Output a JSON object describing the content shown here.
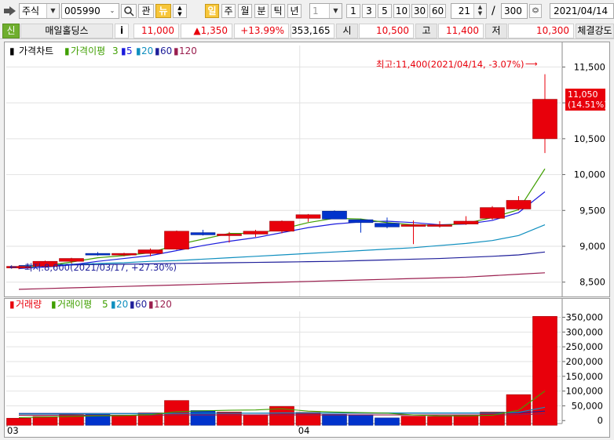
{
  "toolbar": {
    "market_type": "주식",
    "stock_code": "005990",
    "btn_interest": "관",
    "btn_news": "뉴",
    "period_buttons": [
      "일",
      "주",
      "월",
      "분",
      "틱",
      "년"
    ],
    "interval_select": "1",
    "quick_intervals": [
      "1",
      "3",
      "5",
      "10",
      "30",
      "60"
    ],
    "bar_count": "21",
    "slash": "/",
    "total_count": "300",
    "date": "2021/04/14"
  },
  "quote": {
    "credit_badge": "신",
    "stock_name": "매일홀딩스",
    "info_button": "i",
    "price": "11,000",
    "change": "▲1,350",
    "change_pct": "+13.99%",
    "volume": "353,165",
    "open_label": "시",
    "open": "10,500",
    "high_label": "고",
    "high": "11,400",
    "low_label": "저",
    "low": "10,300",
    "strength_label": "체결강도"
  },
  "colors": {
    "up": "#e8000b",
    "down": "#0033cc",
    "ma3": "#3f9f00",
    "ma5": "#1a1adc",
    "ma20": "#0f8fbf",
    "ma60": "#1e1e9a",
    "ma120": "#9a1e4e"
  },
  "chart_data": [
    {
      "type": "candlestick",
      "legend": [
        {
          "text": "가격차트",
          "color": "#000000"
        },
        {
          "text": "가격이평",
          "color": "#3f9f00"
        },
        {
          "text": "3",
          "color": "#3f9f00"
        },
        {
          "text": "5",
          "color": "#1a1adc"
        },
        {
          "text": "20",
          "color": "#0f8fbf"
        },
        {
          "text": "60",
          "color": "#1e1e9a"
        },
        {
          "text": "120",
          "color": "#9a1e4e"
        }
      ],
      "ylim": [
        8300,
        11800
      ],
      "yticks": [
        "8,500",
        "9,000",
        "9,500",
        "10,000",
        "10,500",
        "11,000",
        "11,500"
      ],
      "ytick_values": [
        8500,
        9000,
        9500,
        10000,
        10500,
        11000,
        11500
      ],
      "xticks": [
        {
          "label": "03",
          "index": 0
        },
        {
          "label": "04",
          "index": 11
        }
      ],
      "candles": [
        {
          "o": 8700,
          "h": 8730,
          "l": 8680,
          "c": 8720
        },
        {
          "o": 8720,
          "h": 8800,
          "l": 8700,
          "c": 8790
        },
        {
          "o": 8790,
          "h": 8840,
          "l": 8760,
          "c": 8830
        },
        {
          "o": 8900,
          "h": 8920,
          "l": 8870,
          "c": 8890
        },
        {
          "o": 8890,
          "h": 8910,
          "l": 8860,
          "c": 8900
        },
        {
          "o": 8900,
          "h": 8970,
          "l": 8860,
          "c": 8950
        },
        {
          "o": 8960,
          "h": 9220,
          "l": 8950,
          "c": 9210
        },
        {
          "o": 9190,
          "h": 9230,
          "l": 9150,
          "c": 9160
        },
        {
          "o": 9170,
          "h": 9200,
          "l": 9050,
          "c": 9170
        },
        {
          "o": 9170,
          "h": 9230,
          "l": 9130,
          "c": 9210
        },
        {
          "o": 9210,
          "h": 9360,
          "l": 9180,
          "c": 9350
        },
        {
          "o": 9390,
          "h": 9450,
          "l": 9340,
          "c": 9440
        },
        {
          "o": 9490,
          "h": 9500,
          "l": 9380,
          "c": 9380
        },
        {
          "o": 9370,
          "h": 9380,
          "l": 9190,
          "c": 9330
        },
        {
          "o": 9320,
          "h": 9400,
          "l": 9250,
          "c": 9270
        },
        {
          "o": 9290,
          "h": 9360,
          "l": 9030,
          "c": 9300
        },
        {
          "o": 9300,
          "h": 9350,
          "l": 9260,
          "c": 9300
        },
        {
          "o": 9310,
          "h": 9420,
          "l": 9300,
          "c": 9350
        },
        {
          "o": 9390,
          "h": 9560,
          "l": 9370,
          "c": 9540
        },
        {
          "o": 9520,
          "h": 9700,
          "l": 9500,
          "c": 9640
        },
        {
          "o": 10500,
          "h": 11400,
          "l": 10300,
          "c": 11050
        }
      ],
      "ma3": [
        8700,
        8730,
        8780,
        8840,
        8870,
        8910,
        9020,
        9100,
        9180,
        9180,
        9240,
        9330,
        9390,
        9380,
        9330,
        9300,
        9290,
        9320,
        9400,
        9510,
        10080
      ],
      "ma5": [
        8690,
        8710,
        8740,
        8790,
        8830,
        8870,
        8940,
        9010,
        9070,
        9120,
        9190,
        9260,
        9310,
        9340,
        9350,
        9330,
        9300,
        9310,
        9360,
        9470,
        9760
      ],
      "ma20": [
        8720,
        8740,
        8750,
        8760,
        8770,
        8790,
        8800,
        8820,
        8840,
        8860,
        8880,
        8900,
        8920,
        8940,
        8960,
        8980,
        9010,
        9040,
        9080,
        9150,
        9300
      ],
      "ma60": [
        8730,
        8735,
        8740,
        8745,
        8750,
        8755,
        8760,
        8765,
        8770,
        8775,
        8780,
        8785,
        8790,
        8800,
        8810,
        8820,
        8830,
        8845,
        8860,
        8880,
        8920
      ],
      "ma120": [
        8400,
        8410,
        8420,
        8430,
        8440,
        8450,
        8460,
        8470,
        8480,
        8490,
        8500,
        8510,
        8520,
        8530,
        8540,
        8550,
        8560,
        8570,
        8590,
        8610,
        8630
      ],
      "annotations": {
        "high": "최고:11,400(2021/04/14, -3.07%)",
        "low": "최저:8,600(2021/03/17, +27.30%)",
        "last_price": "11,050",
        "last_pct": "(14.51%)"
      }
    },
    {
      "type": "bar",
      "legend": [
        {
          "text": "거래량",
          "color": "#e8000b"
        },
        {
          "text": "거래이평",
          "color": "#3f9f00"
        },
        {
          "text": "5",
          "color": "#3f9f00"
        },
        {
          "text": "20",
          "color": "#0f8fbf"
        },
        {
          "text": "60",
          "color": "#1e1e9a"
        },
        {
          "text": "120",
          "color": "#9a1e4e"
        }
      ],
      "ylim": [
        -10000,
        370000
      ],
      "yticks": [
        "0",
        "50,000",
        "100,000",
        "150,000",
        "200,000",
        "250,000",
        "300,000",
        "350,000"
      ],
      "ytick_values": [
        0,
        50000,
        100000,
        150000,
        200000,
        250000,
        300000,
        350000
      ],
      "volumes": [
        8000,
        14000,
        20000,
        22000,
        17000,
        26000,
        68000,
        34000,
        29000,
        20000,
        48000,
        28000,
        21000,
        20000,
        9000,
        15000,
        14000,
        19000,
        29000,
        88000,
        353000
      ],
      "ma5": [
        10000,
        12000,
        14000,
        16000,
        17000,
        20000,
        30000,
        33000,
        35000,
        36000,
        40000,
        32000,
        29000,
        27000,
        25000,
        19000,
        16000,
        16000,
        18000,
        35000,
        100000
      ],
      "ma20": [
        22000,
        22000,
        22000,
        23000,
        23000,
        23000,
        24000,
        25000,
        25000,
        25000,
        26000,
        26000,
        26000,
        26000,
        26000,
        26000,
        26000,
        26000,
        26000,
        28000,
        45000
      ],
      "ma60": [
        24000,
        24000,
        24000,
        24000,
        24000,
        24000,
        25000,
        25000,
        25000,
        25000,
        25000,
        25000,
        25000,
        25000,
        25000,
        25000,
        25000,
        25000,
        25000,
        26000,
        32000
      ],
      "ma120": [
        18000,
        18000,
        18000,
        18000,
        18000,
        18000,
        19000,
        19000,
        19000,
        19000,
        19000,
        19000,
        19000,
        19000,
        19000,
        19000,
        19000,
        19000,
        19000,
        20000,
        23000
      ]
    }
  ]
}
